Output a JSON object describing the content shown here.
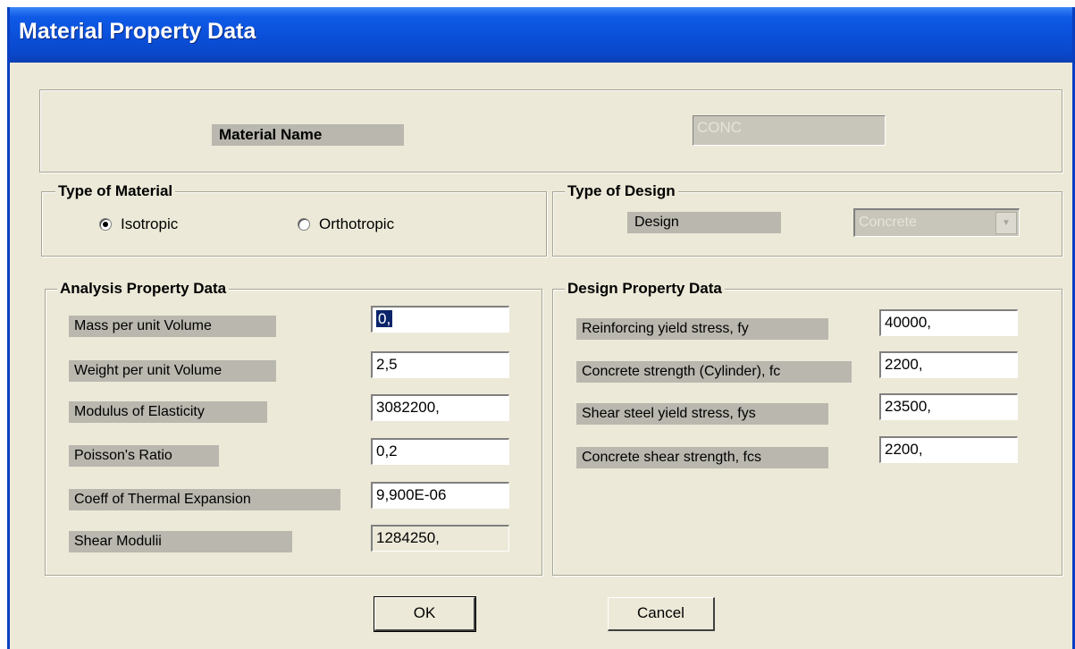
{
  "window": {
    "title": "Material Property Data"
  },
  "material_name": {
    "label": "Material Name",
    "value": "CONC"
  },
  "type_of_material": {
    "legend": "Type of Material",
    "options": [
      {
        "label": "Isotropic",
        "checked": true
      },
      {
        "label": "Orthotropic",
        "checked": false
      }
    ]
  },
  "type_of_design": {
    "legend": "Type of Design",
    "design_label": "Design",
    "design_value": "Concrete"
  },
  "analysis": {
    "legend": "Analysis Property Data",
    "rows": [
      {
        "label": "Mass per unit Volume",
        "value": "0,"
      },
      {
        "label": "Weight per unit Volume",
        "value": "2,5"
      },
      {
        "label": "Modulus of Elasticity",
        "value": "3082200,"
      },
      {
        "label": "Poisson's Ratio",
        "value": "0,2"
      },
      {
        "label": "Coeff of Thermal Expansion",
        "value": "9,900E-06"
      },
      {
        "label": "Shear Modulii",
        "value": "1284250,"
      }
    ]
  },
  "design": {
    "legend": "Design Property Data",
    "rows": [
      {
        "label": "Reinforcing yield stress, fy",
        "value": "40000,"
      },
      {
        "label": "Concrete strength (Cylinder), fc",
        "value": "2200,"
      },
      {
        "label": "Shear steel yield stress, fys",
        "value": "23500,"
      },
      {
        "label": "Concrete shear strength, fcs",
        "value": "2200,"
      }
    ]
  },
  "buttons": {
    "ok": "OK",
    "cancel": "Cancel"
  }
}
